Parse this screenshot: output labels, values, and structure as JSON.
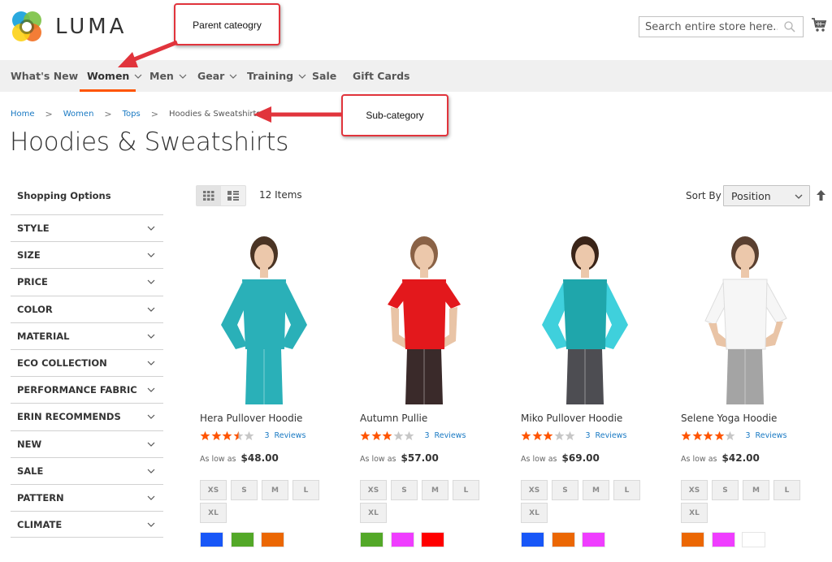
{
  "header": {
    "logo_text": "LUMA",
    "search_placeholder": "Search entire store here...",
    "icons": {
      "search": "magnifier-icon",
      "cart": "shopping-cart-icon"
    }
  },
  "nav": {
    "items": [
      {
        "label": "What's New",
        "has_dropdown": false,
        "active": false
      },
      {
        "label": "Women",
        "has_dropdown": true,
        "active": true
      },
      {
        "label": "Men",
        "has_dropdown": true,
        "active": false
      },
      {
        "label": "Gear",
        "has_dropdown": true,
        "active": false
      },
      {
        "label": "Training",
        "has_dropdown": true,
        "active": false
      },
      {
        "label": "Sale",
        "has_dropdown": false,
        "active": false
      },
      {
        "label": "Gift Cards",
        "has_dropdown": false,
        "active": false
      }
    ],
    "active_color": "#ff5501"
  },
  "annotations": {
    "parent": "Parent cateogry",
    "sub": "Sub-category",
    "color": "#e1343c"
  },
  "breadcrumbs": {
    "items": [
      "Home",
      "Women",
      "Tops"
    ],
    "current": "Hoodies & Sweatshirts",
    "separator": ">"
  },
  "page_title": "Hoodies & Sweatshirts",
  "sidebar": {
    "title": "Shopping Options",
    "filters": [
      "STYLE",
      "SIZE",
      "PRICE",
      "COLOR",
      "MATERIAL",
      "ECO COLLECTION",
      "PERFORMANCE FABRIC",
      "ERIN RECOMMENDS",
      "NEW",
      "SALE",
      "PATTERN",
      "CLIMATE"
    ]
  },
  "toolbar": {
    "view_modes": [
      "grid",
      "list"
    ],
    "active_mode": "grid",
    "count": "12 Items",
    "sort_label": "Sort By",
    "sort_value": "Position",
    "sort_direction": "ascending"
  },
  "products": [
    {
      "name": "Hera Pullover Hoodie",
      "rating": 3.5,
      "reviews_count": "3",
      "reviews_label": "Reviews",
      "price_prefix": "As low as",
      "price": "$48.00",
      "sizes": [
        "XS",
        "S",
        "M",
        "L",
        "XL"
      ],
      "colors": [
        "#1857f7",
        "#53a828",
        "#eb6703"
      ],
      "image": {
        "top": "#2ab0b8",
        "bottom": "#2ab0b8",
        "hair": "#4a3424",
        "sleeves": "long"
      }
    },
    {
      "name": "Autumn Pullie",
      "rating": 3,
      "reviews_count": "3",
      "reviews_label": "Reviews",
      "price_prefix": "As low as",
      "price": "$57.00",
      "sizes": [
        "XS",
        "S",
        "M",
        "L",
        "XL"
      ],
      "colors": [
        "#53a828",
        "#ef3dff",
        "#ff0000"
      ],
      "image": {
        "top": "#e3181c",
        "bottom": "#3a2a2a",
        "hair": "#8a6246",
        "sleeves": "short"
      }
    },
    {
      "name": "Miko Pullover Hoodie",
      "rating": 3,
      "reviews_count": "3",
      "reviews_label": "Reviews",
      "price_prefix": "As low as",
      "price": "$69.00",
      "sizes": [
        "XS",
        "S",
        "M",
        "L",
        "XL"
      ],
      "colors": [
        "#1857f7",
        "#eb6703",
        "#ef3dff"
      ],
      "image": {
        "top": "#1fa6ab",
        "bottom": "#4d4d52",
        "hair": "#3a2418",
        "sleeves": "long",
        "sleeve_color": "#3fd0dc"
      }
    },
    {
      "name": "Selene Yoga Hoodie",
      "rating": 4,
      "reviews_count": "3",
      "reviews_label": "Reviews",
      "price_prefix": "As low as",
      "price": "$42.00",
      "sizes": [
        "XS",
        "S",
        "M",
        "L",
        "XL"
      ],
      "colors": [
        "#eb6703",
        "#ef3dff",
        "#ffffff"
      ],
      "image": {
        "top": "#f6f6f6",
        "bottom": "#a4a4a4",
        "hair": "#5a4030",
        "sleeves": "three-quarter"
      }
    }
  ],
  "colors": {
    "link": "#1979c3",
    "star_on": "#ff5501",
    "star_off": "#c7c7c7"
  }
}
